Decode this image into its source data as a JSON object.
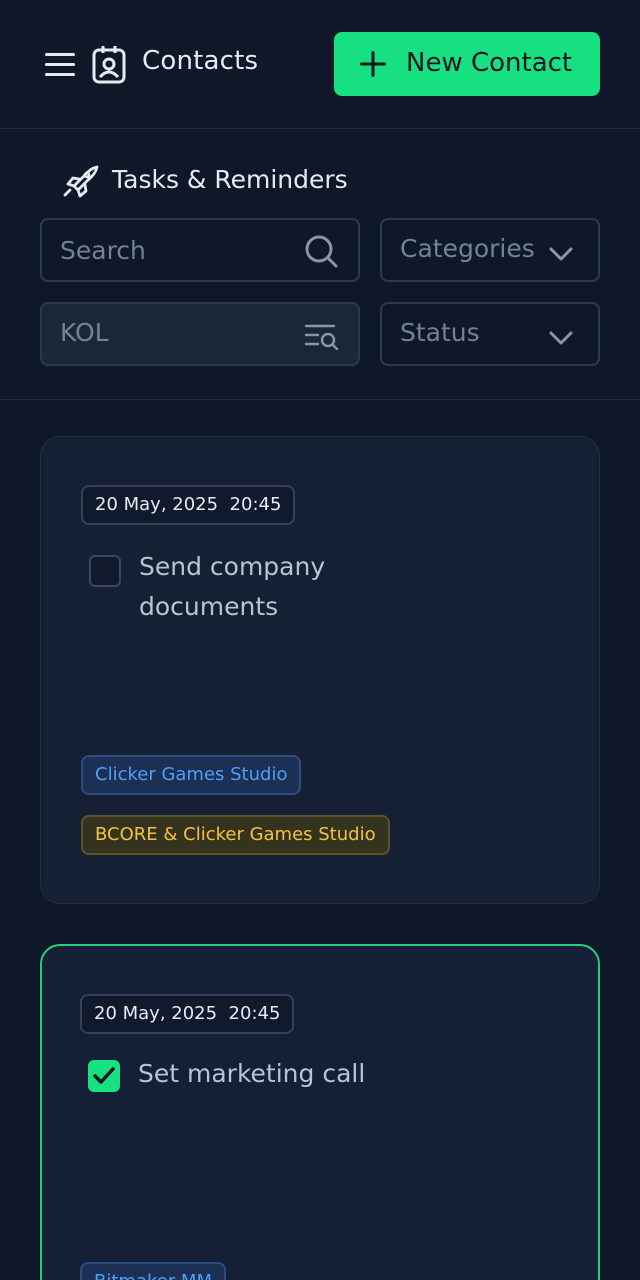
{
  "header": {
    "title": "Contacts",
    "new_button_label": "New Contact",
    "icons": {
      "menu": "menu-icon",
      "contacts": "contacts-icon",
      "plus": "plus-icon"
    }
  },
  "filters": {
    "section_title": "Tasks & Reminders",
    "section_icon": "rocket-icon",
    "search_placeholder": "Search",
    "categories_label": "Categories",
    "kol_value": "KOL",
    "status_label": "Status"
  },
  "tasks": [
    {
      "date": "20 May, 2025  20:45",
      "title": "Send company documents",
      "checked": false,
      "tags": [
        {
          "label": "Clicker Games Studio",
          "color": "#4ea0f5"
        },
        {
          "label": "BCORE & Clicker Games Studio",
          "color": "#f5c33b"
        }
      ]
    },
    {
      "date": "20 May, 2025  20:45",
      "title": "Set marketing call",
      "checked": true,
      "tags": [
        {
          "label": "Bitmaker MM",
          "color": "#4ea0f5"
        }
      ]
    }
  ],
  "colors": {
    "accent": "#17e080",
    "background": "#0f1829",
    "card": "#162035"
  }
}
